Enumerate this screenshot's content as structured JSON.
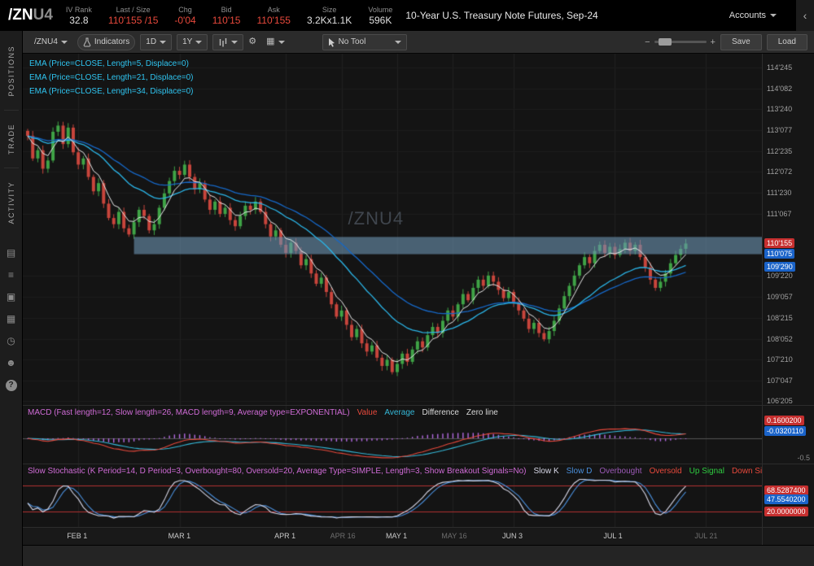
{
  "header": {
    "symbol": "/ZN",
    "symbol_suffix": "U4",
    "stats": [
      {
        "id": "iv-rank",
        "label": "IV Rank",
        "value": "32.8",
        "color": "#e0e0e0"
      },
      {
        "id": "last-size",
        "label": "Last / Size",
        "value": "110'155 /15",
        "color": "#e8493c"
      },
      {
        "id": "chg",
        "label": "Chg",
        "value": "-0'04",
        "color": "#e8493c"
      },
      {
        "id": "bid",
        "label": "Bid",
        "value": "110'15",
        "color": "#e8493c"
      },
      {
        "id": "ask",
        "label": "Ask",
        "value": "110'155",
        "color": "#e8493c"
      },
      {
        "id": "size",
        "label": "Size",
        "value": "3.2Kx1.1K",
        "color": "#e0e0e0"
      },
      {
        "id": "volume",
        "label": "Volume",
        "value": "596K",
        "color": "#e0e0e0"
      }
    ],
    "description": "10-Year U.S. Treasury Note Futures, Sep-24",
    "accounts_label": "Accounts",
    "collapse_glyph": "‹"
  },
  "sidebar": {
    "tabs": [
      {
        "id": "positions",
        "label": "POSITIONS"
      },
      {
        "id": "trade",
        "label": "TRADE"
      },
      {
        "id": "activity",
        "label": "ACTIVITY"
      }
    ],
    "icons": [
      {
        "name": "notebook-icon",
        "glyph": "▤"
      },
      {
        "name": "watchlist-icon",
        "glyph": "≡"
      },
      {
        "name": "monitor-icon",
        "glyph": "▣"
      },
      {
        "name": "apps-grid-icon",
        "glyph": "▦"
      },
      {
        "name": "clock-icon",
        "glyph": "◷"
      },
      {
        "name": "community-icon",
        "glyph": "☻"
      },
      {
        "name": "help-icon",
        "glyph": "?"
      }
    ]
  },
  "toolbar": {
    "symbol": "/ZNU4",
    "indicators_label": "Indicators",
    "timeframe": "1D",
    "range": "1Y",
    "tool_label": "No Tool",
    "save_label": "Save",
    "load_label": "Load",
    "gear_glyph": "⚙",
    "grid_glyph": "▦",
    "zoom_out_glyph": "−",
    "zoom_in_glyph": "+"
  },
  "chart": {
    "ema_labels": [
      "EMA (Price=CLOSE, Length=5, Displace=0)",
      "EMA (Price=CLOSE, Length=21, Displace=0)",
      "EMA (Price=CLOSE, Length=34, Displace=0)"
    ],
    "watermark": "/ZNU4"
  },
  "macd_panel": {
    "title": "MACD (Fast length=12, Slow length=26, MACD length=9, Average type=EXPONENTIAL)",
    "legend": [
      {
        "label": "Value",
        "color": "#e8493c"
      },
      {
        "label": "Average",
        "color": "#35b8d8"
      },
      {
        "label": "Difference",
        "color": "#d8d8d8"
      },
      {
        "label": "Zero line",
        "color": "#d8d8d8"
      }
    ],
    "badges": [
      {
        "value": "0.1600200",
        "bg": "#c62f2f"
      },
      {
        "value": "-0.0320110",
        "bg": "#1a63c9"
      }
    ],
    "scale_label": "-0.5"
  },
  "stoch_panel": {
    "title": "Slow Stochastic (K Period=14, D Period=3, Overbought=80, Oversold=20, Average Type=SIMPLE, Length=3, Show Breakout Signals=No)",
    "legend": [
      {
        "label": "Slow K",
        "color": "#d8d8e8"
      },
      {
        "label": "Slow D",
        "color": "#4a8fdc"
      },
      {
        "label": "Overbought",
        "color": "#9b59b6"
      },
      {
        "label": "Oversold",
        "color": "#e8493c"
      },
      {
        "label": "Up Signal",
        "color": "#2ecc40"
      },
      {
        "label": "Down Signal",
        "color": "#e8493c"
      }
    ],
    "badges": [
      {
        "value": "68.5287400",
        "bg": "#c62f2f",
        "at": 68.5
      },
      {
        "value": "47.5540200",
        "bg": "#1a63c9",
        "at": 47.55
      },
      {
        "value": "20.0000000",
        "bg": "#c62f2f",
        "at": 20
      }
    ]
  },
  "chart_data": {
    "type": "candlestick",
    "symbol": "/ZNU4",
    "timeframe": "1D",
    "range": "1Y",
    "ylim": [
      106.55,
      115.1
    ],
    "total_slots": 146,
    "band_price_range": [
      110.22,
      110.64
    ],
    "band_start_index": 21,
    "closes": [
      113.1,
      112.55,
      112.75,
      112.3,
      112.5,
      113.2,
      113.35,
      112.9,
      113.3,
      112.7,
      112.4,
      112.55,
      112.1,
      111.75,
      111.95,
      111.45,
      111.1,
      110.95,
      111.25,
      110.85,
      110.7,
      111.0,
      111.3,
      111.15,
      110.8,
      110.95,
      111.35,
      111.7,
      112.0,
      112.25,
      112.15,
      112.4,
      112.1,
      111.8,
      111.95,
      111.55,
      111.3,
      111.5,
      111.2,
      111.35,
      111.05,
      110.9,
      111.15,
      111.4,
      111.3,
      111.5,
      111.25,
      110.95,
      110.65,
      110.8,
      110.45,
      110.25,
      110.5,
      110.3,
      109.95,
      110.1,
      109.75,
      109.5,
      109.65,
      109.3,
      109.0,
      108.7,
      108.85,
      108.5,
      108.2,
      108.4,
      108.05,
      107.85,
      108.0,
      107.7,
      107.5,
      107.65,
      107.35,
      107.55,
      107.8,
      107.6,
      107.9,
      108.1,
      107.95,
      108.25,
      108.45,
      108.3,
      108.6,
      108.85,
      108.7,
      109.0,
      109.25,
      109.1,
      109.4,
      109.6,
      109.45,
      109.7,
      109.55,
      109.35,
      109.15,
      109.3,
      109.05,
      108.85,
      108.65,
      108.4,
      108.55,
      108.3,
      108.15,
      108.35,
      108.6,
      108.9,
      109.2,
      109.45,
      109.7,
      109.95,
      110.15,
      110.0,
      110.3,
      110.45,
      110.25,
      110.4,
      110.2,
      110.35,
      110.5,
      110.3,
      110.45,
      110.15,
      109.9,
      109.6,
      109.4,
      109.55,
      109.75,
      110.0,
      110.2,
      110.35,
      110.48
    ],
    "x_ticks": [
      {
        "label": "FEB 1",
        "index": 10,
        "dim": false
      },
      {
        "label": "MAR 1",
        "index": 30,
        "dim": false
      },
      {
        "label": "APR 1",
        "index": 51,
        "dim": false
      },
      {
        "label": "APR 16",
        "index": 62,
        "dim": true
      },
      {
        "label": "MAY 1",
        "index": 73,
        "dim": false
      },
      {
        "label": "MAY 16",
        "index": 84,
        "dim": true
      },
      {
        "label": "JUN 3",
        "index": 96,
        "dim": false
      },
      {
        "label": "JUL 1",
        "index": 116,
        "dim": false
      },
      {
        "label": "JUL 21",
        "index": 134,
        "dim": true
      }
    ],
    "y_axis_labels": [
      {
        "label": "114'245",
        "price": 114.766
      },
      {
        "label": "114'082",
        "price": 114.256
      },
      {
        "label": "113'240",
        "price": 113.75
      },
      {
        "label": "113'077",
        "price": 113.241
      },
      {
        "label": "112'235",
        "price": 112.734
      },
      {
        "label": "112'072",
        "price": 112.225
      },
      {
        "label": "111'230",
        "price": 111.719
      },
      {
        "label": "111'067",
        "price": 111.209
      },
      {
        "label": "109'220",
        "price": 109.688
      },
      {
        "label": "109'057",
        "price": 109.178
      },
      {
        "label": "108'215",
        "price": 108.672
      },
      {
        "label": "108'052",
        "price": 108.163
      },
      {
        "label": "107'210",
        "price": 107.656
      },
      {
        "label": "107'047",
        "price": 107.147
      },
      {
        "label": "106'205",
        "price": 106.641
      }
    ],
    "price_badges": [
      {
        "label": "110'155",
        "price": 110.484,
        "bg": "#c62f2f"
      },
      {
        "label": "110'075",
        "price": 110.234,
        "bg": "#1a63c9"
      },
      {
        "label": "109'290",
        "price": 109.906,
        "bg": "#1a63c9"
      }
    ],
    "indicator_params": {
      "ema_lengths": [
        5,
        21,
        34
      ],
      "macd": {
        "fast": 12,
        "slow": 26,
        "signal": 9
      },
      "stoch": {
        "k_period": 14,
        "d_period": 3,
        "overbought": 80,
        "oversold": 20
      }
    },
    "colors": {
      "up": "#3fa346",
      "down": "#c8453c",
      "ema5": "#e8e8e8",
      "ema21": "#2bb5e8",
      "ema34": "#1668c8",
      "band": "rgba(108,148,178,0.6)",
      "macd_value": "#e8493c",
      "macd_avg": "#35b8d8",
      "macd_hist": "#b36ae2",
      "zero_line": "#555555",
      "stoch_k": "#d8d8e8",
      "stoch_d": "#4a8fdc",
      "stoch_levels": "#b03030",
      "grid": "#202020",
      "hgrid": "#1d1d1d"
    }
  }
}
